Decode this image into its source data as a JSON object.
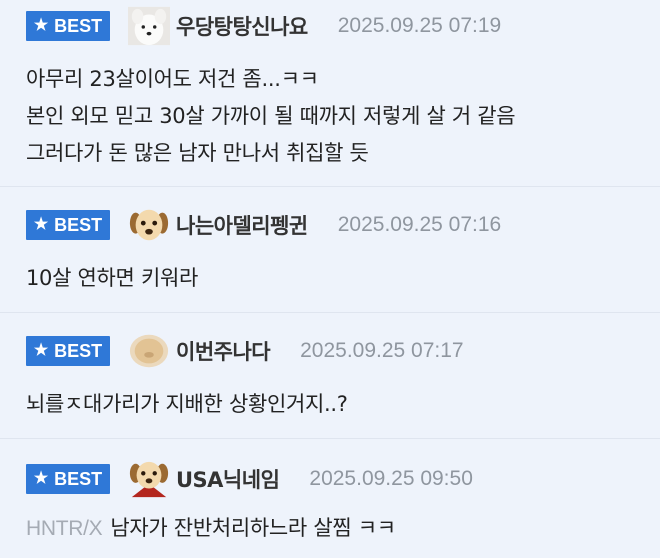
{
  "comments": [
    {
      "badge": "BEST",
      "avatar": "white-dog-avatar",
      "nickname": "우당탕탕신나요",
      "date": "2025.09.25 07:19",
      "lines": [
        "아무리 23살이어도 저건 좀...ㅋㅋ",
        "본인 외모 믿고 30살 가까이 될 때까지 저렇게 살 거 같음",
        "그러다가 돈 많은 남자 만나서 취집할 듯"
      ]
    },
    {
      "badge": "BEST",
      "avatar": "puppy-avatar",
      "nickname": "나는아델리펭귄",
      "date": "2025.09.25 07:16",
      "lines": [
        "10살 연하면 키워라"
      ]
    },
    {
      "badge": "BEST",
      "avatar": "blurred-puppy-avatar",
      "nickname": "이번주나다",
      "date": "2025.09.25 07:17",
      "lines": [
        "뇌를ㅈ대가리가 지배한 상황인거지..?"
      ]
    },
    {
      "badge": "BEST",
      "avatar": "puppy-red-cape-avatar",
      "nickname": "USA닉네임",
      "date": "2025.09.25 09:50",
      "prefix": "HNTR/X",
      "lines": [
        "남자가 잔반처리하느라 살찜 ㅋㅋ"
      ]
    }
  ],
  "colors": {
    "background": "#eef3fb",
    "badge": "#2f78d7",
    "date": "#8f969f",
    "prefix": "#a5abb4"
  }
}
